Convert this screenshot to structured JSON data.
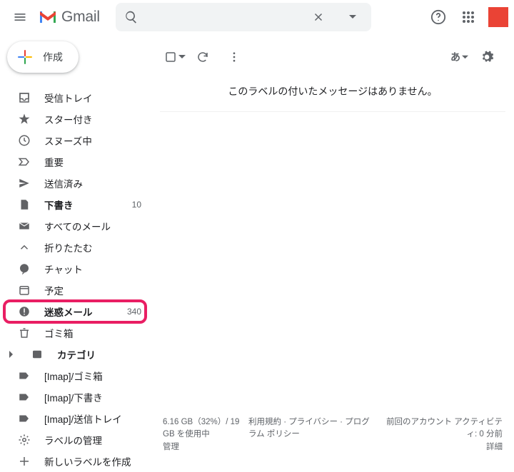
{
  "header": {
    "product": "Gmail",
    "langIndicator": "あ"
  },
  "compose": {
    "label": "作成"
  },
  "sidebar": {
    "items": [
      {
        "icon": "inbox",
        "label": "受信トレイ"
      },
      {
        "icon": "star",
        "label": "スター付き"
      },
      {
        "icon": "clock",
        "label": "スヌーズ中"
      },
      {
        "icon": "important",
        "label": "重要"
      },
      {
        "icon": "send",
        "label": "送信済み"
      },
      {
        "icon": "draft",
        "label": "下書き",
        "bold": true,
        "count": "10"
      },
      {
        "icon": "allmail",
        "label": "すべてのメール"
      },
      {
        "icon": "collapse",
        "label": "折りたたむ"
      },
      {
        "icon": "chat",
        "label": "チャット"
      },
      {
        "icon": "calendar",
        "label": "予定"
      },
      {
        "icon": "spam",
        "label": "迷惑メール",
        "bold": true,
        "count": "340",
        "highlight": true
      },
      {
        "icon": "trash",
        "label": "ゴミ箱"
      },
      {
        "icon": "category",
        "label": "カテゴリ",
        "bold": true,
        "expand": true
      },
      {
        "icon": "label",
        "label": "[Imap]/ゴミ箱"
      },
      {
        "icon": "label",
        "label": "[Imap]/下書き"
      },
      {
        "icon": "label",
        "label": "[Imap]/送信トレイ"
      },
      {
        "icon": "settings",
        "label": "ラベルの管理"
      },
      {
        "icon": "plus",
        "label": "新しいラベルを作成"
      }
    ]
  },
  "main": {
    "emptyMessage": "このラベルの付いたメッセージはありません。"
  },
  "footer": {
    "storageLine1": "6.16 GB（32%）/ 19 GB を使用中",
    "storageLine2": "管理",
    "policies": "利用規約 · プライバシー · プログラム ポリシー",
    "activityLine1": "前回のアカウント アクティビティ: 0 分前",
    "activityLine2": "詳細"
  }
}
